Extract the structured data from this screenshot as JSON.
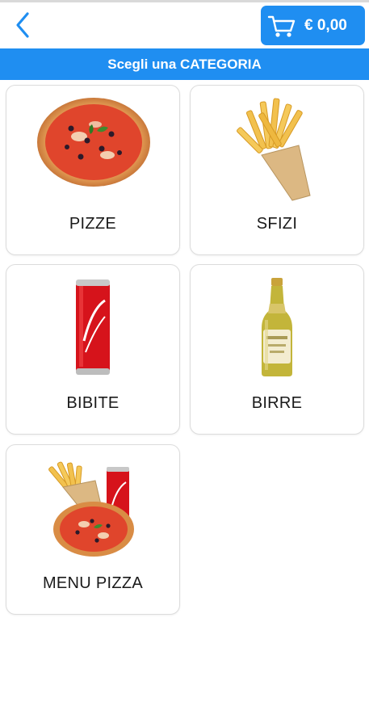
{
  "header": {
    "cart_total": "€ 0,00"
  },
  "category_bar": {
    "title": "Scegli una CATEGORIA"
  },
  "categories": [
    {
      "label": "PIZZE"
    },
    {
      "label": "SFIZI"
    },
    {
      "label": "BIBITE"
    },
    {
      "label": "BIRRE"
    },
    {
      "label": "MENU PIZZA"
    }
  ],
  "colors": {
    "accent": "#1f8ef1",
    "back_arrow": "#1f8ef1",
    "card_border": "#dcdcdc"
  },
  "icons": [
    "back-arrow-icon",
    "cart-icon"
  ]
}
